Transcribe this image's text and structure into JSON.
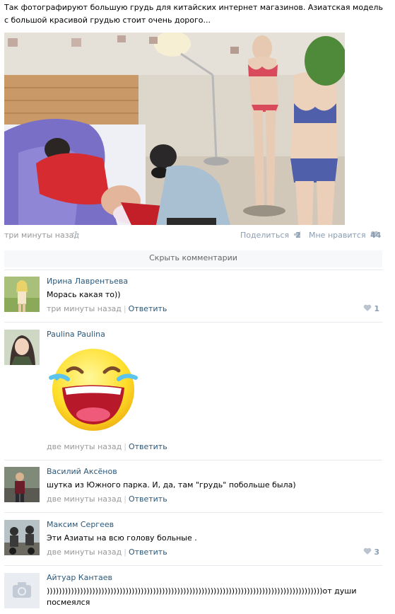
{
  "post": {
    "text": "Так фотографируют большую грудь для китайских интернет магазинов. Азиатская модель с большой красивой грудью стоит очень дорого...",
    "time": "три минуты назад",
    "share_label": "Поделиться",
    "share_count": "2",
    "like_label": "Мне нравится",
    "like_count": "44"
  },
  "hide_comments_label": "Скрыть комментарии",
  "comments": [
    {
      "author": "Ирина Лаврентьева",
      "text": "Морась какая то))",
      "time": "три минуты назад",
      "reply": "Ответить",
      "likes": "1"
    },
    {
      "author": "Paulina Paulina",
      "text": "",
      "time": "две минуты назад",
      "reply": "Ответить",
      "likes": ""
    },
    {
      "author": "Василий Аксёнов",
      "text": "шутка из Южного парка. И, да, там \"грудь\" побольше была)",
      "time": "две минуты назад",
      "reply": "Ответить",
      "likes": ""
    },
    {
      "author": "Максим Сергеев",
      "text": "Эти Азиаты на всю голову больные .",
      "time": "две минуты назад",
      "reply": "Ответить",
      "likes": "3"
    },
    {
      "author": "Айтуар Кантаев",
      "text": ")))))))))))))))))))))))))))))))))))))))))))))))))))))))))))))))))))))))))))))))))))))))))))от души посмеялся",
      "time": "",
      "reply": "",
      "likes": ""
    }
  ],
  "icons": {
    "settings": "gear-icon",
    "share": "megaphone-icon",
    "like": "heart-icon",
    "camera": "camera-icon"
  },
  "colors": {
    "link": "#2b587a",
    "muted": "#999999",
    "accent": "#8a9db1"
  }
}
